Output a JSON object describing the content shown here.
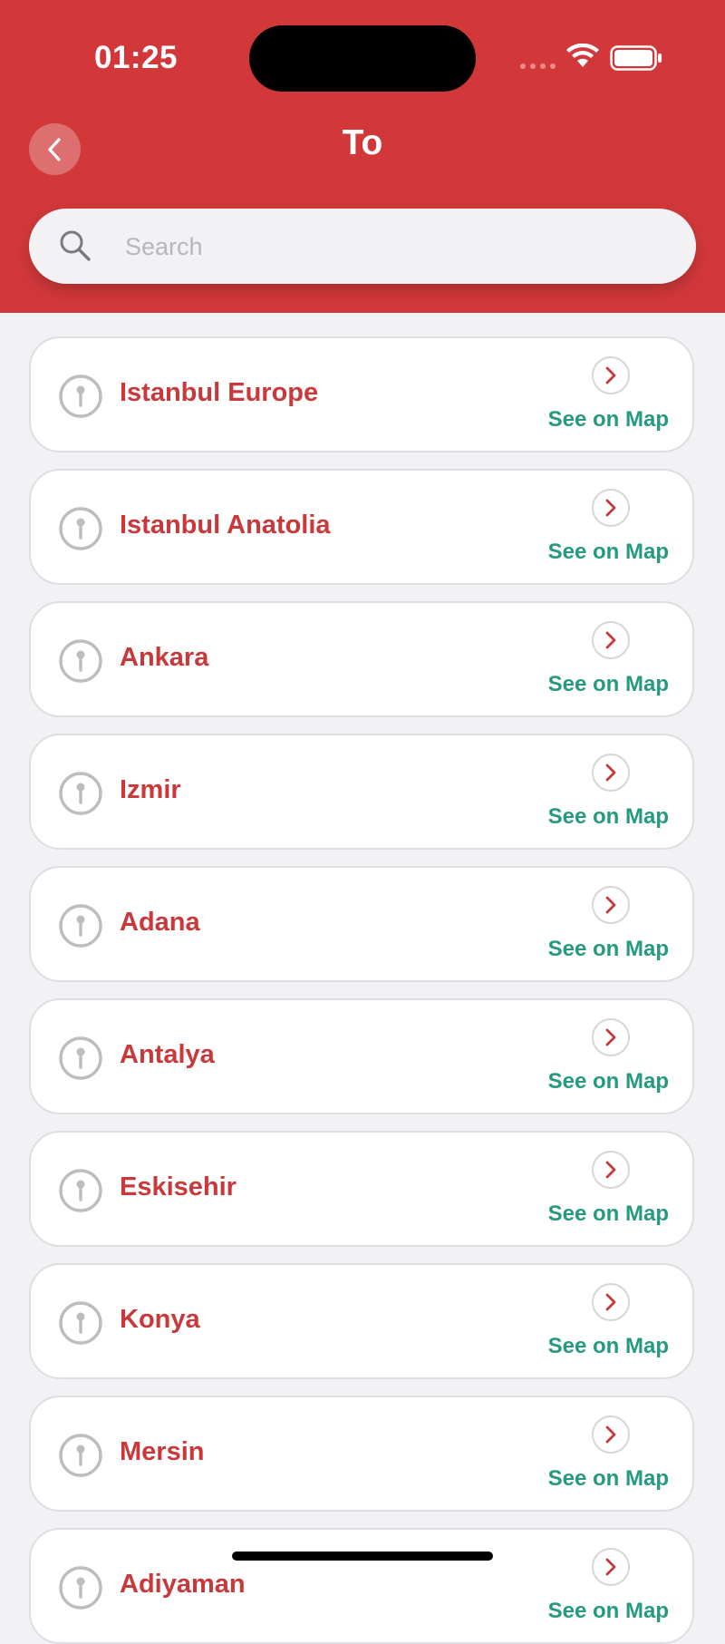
{
  "status_bar": {
    "time": "01:25"
  },
  "header": {
    "title": "To"
  },
  "search": {
    "placeholder": "Search"
  },
  "see_on_map_label": "See on Map",
  "colors": {
    "header_bg": "#d2383a",
    "city_text": "#c9393b",
    "link_text": "#269a80",
    "page_bg": "#f2f2f4"
  },
  "icons": {
    "back": "chevron-left-icon",
    "search": "search-icon",
    "pin": "pin-icon",
    "chevron": "chevron-right-icon"
  },
  "cities": [
    "Istanbul Europe",
    "Istanbul Anatolia",
    "Ankara",
    "Izmir",
    "Adana",
    "Antalya",
    "Eskisehir",
    "Konya",
    "Mersin",
    "Adiyaman"
  ]
}
